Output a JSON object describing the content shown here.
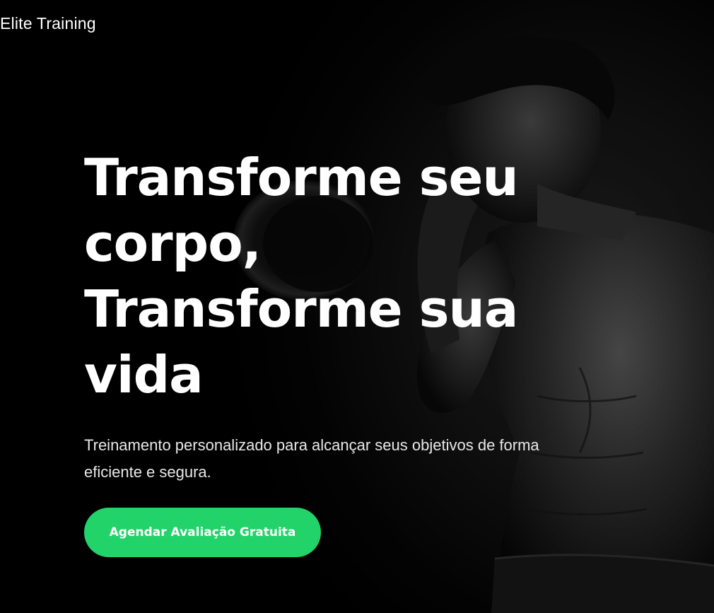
{
  "brand": {
    "name": "Elite Training"
  },
  "hero": {
    "headline": [
      "Transforme seu",
      "corpo,",
      "Transforme sua vida"
    ],
    "subtitle": "Treinamento personalizado para alcançar seus objetivos de forma eficiente e segura.",
    "cta_label": "Agendar Avaliação Gratuita"
  },
  "colors": {
    "background": "#000000",
    "accent": "#22d36a",
    "text": "#ffffff"
  }
}
